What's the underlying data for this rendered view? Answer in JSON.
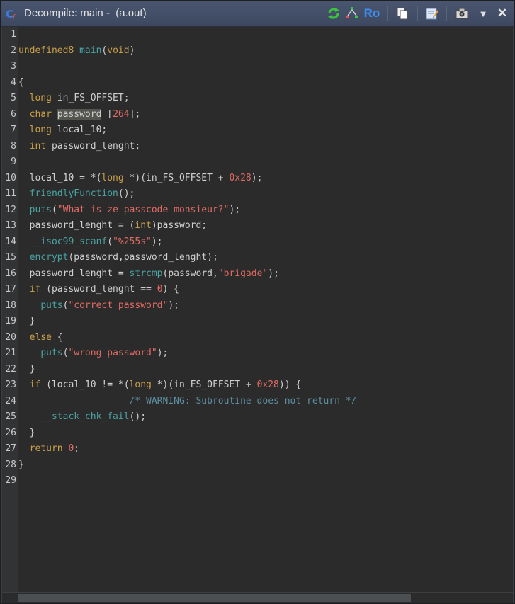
{
  "window": {
    "title": "Decompile: main -  (a.out)",
    "accent": "#4a5670",
    "toolbar": {
      "ro_label": "Ro",
      "close_glyph": "✕",
      "menu_glyph": "▼"
    }
  },
  "code_lines": [
    {
      "n": "1",
      "t": ""
    },
    {
      "n": "2",
      "t": "undefined8 main(void)"
    },
    {
      "n": "3",
      "t": ""
    },
    {
      "n": "4",
      "t": "{"
    },
    {
      "n": "5",
      "t": "  long in_FS_OFFSET;"
    },
    {
      "n": "6",
      "t": "  char password [264];"
    },
    {
      "n": "7",
      "t": "  long local_10;"
    },
    {
      "n": "8",
      "t": "  int password_lenght;"
    },
    {
      "n": "9",
      "t": ""
    },
    {
      "n": "10",
      "t": "  local_10 = *(long *)(in_FS_OFFSET + 0x28);"
    },
    {
      "n": "11",
      "t": "  friendlyFunction();"
    },
    {
      "n": "12",
      "t": "  puts(\"What is ze passcode monsieur?\");"
    },
    {
      "n": "13",
      "t": "  password_lenght = (int)password;"
    },
    {
      "n": "14",
      "t": "  __isoc99_scanf(\"%255s\");"
    },
    {
      "n": "15",
      "t": "  encrypt(password,password_lenght);"
    },
    {
      "n": "16",
      "t": "  password_lenght = strcmp(password,\"brigade\");"
    },
    {
      "n": "17",
      "t": "  if (password_lenght == 0) {"
    },
    {
      "n": "18",
      "t": "    puts(\"correct password\");"
    },
    {
      "n": "19",
      "t": "  }"
    },
    {
      "n": "20",
      "t": "  else {"
    },
    {
      "n": "21",
      "t": "    puts(\"wrong password\");"
    },
    {
      "n": "22",
      "t": "  }"
    },
    {
      "n": "23",
      "t": "  if (local_10 != *(long *)(in_FS_OFFSET + 0x28)) {"
    },
    {
      "n": "24",
      "t": "                    /* WARNING: Subroutine does not return */"
    },
    {
      "n": "25",
      "t": "    __stack_chk_fail();"
    },
    {
      "n": "26",
      "t": "  }"
    },
    {
      "n": "27",
      "t": "  return 0;"
    },
    {
      "n": "28",
      "t": "}"
    },
    {
      "n": "29",
      "t": ""
    }
  ],
  "highlighted_token": "password"
}
